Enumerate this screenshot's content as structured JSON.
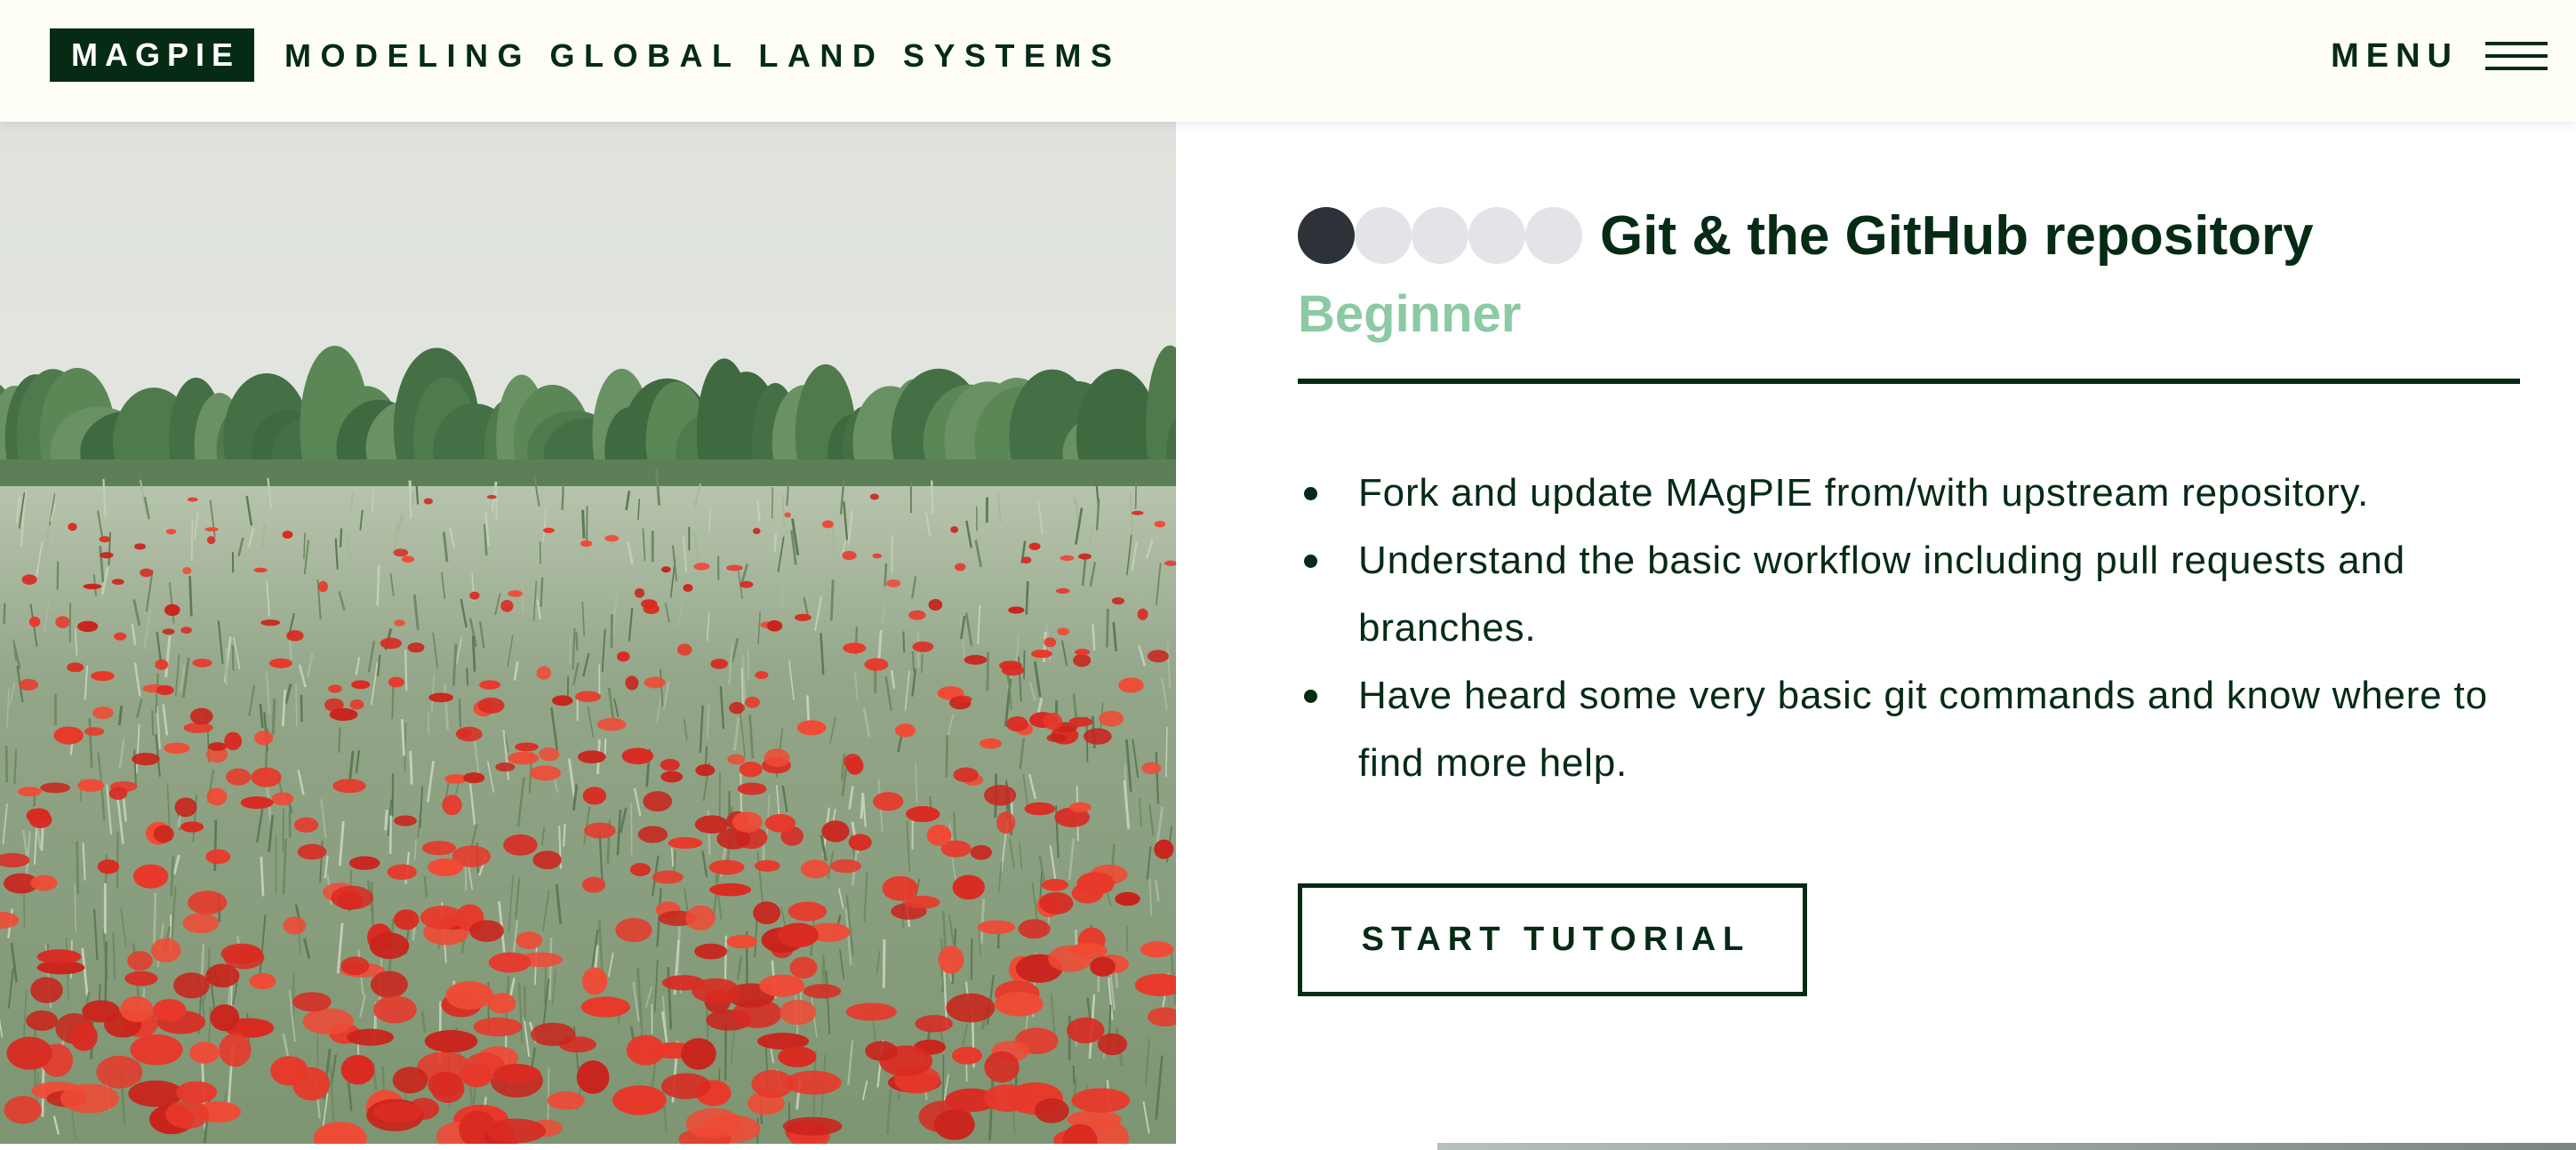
{
  "header": {
    "logo_text": "MAGPIE",
    "tagline": "MODELING GLOBAL LAND SYSTEMS",
    "menu_label": "MENU",
    "menu_icon": "hamburger-icon"
  },
  "hero": {
    "image": "poppy-field-photo",
    "colors": {
      "sky": "#e6e8e2",
      "trees": "#4f7a4c",
      "grass": "#8ea083",
      "poppy": "#e8382a"
    }
  },
  "tutorial": {
    "title": "Git & the GitHub repository",
    "level": "Beginner",
    "level_rating": {
      "filled": 1,
      "total": 5
    },
    "goals": [
      "Fork and update MAgPIE from/with upstream repository.",
      "Understand the basic workflow including pull requests and branches.",
      "Have heard some very basic git commands and know where to find more help."
    ],
    "start_button": "START TUTORIAL"
  },
  "colors": {
    "brand_dark": "#062b15",
    "level_green": "#8ccaa4",
    "dot_active": "#2d3138",
    "dot_inactive": "#e3e4e8",
    "header_bg": "#fefef7"
  }
}
